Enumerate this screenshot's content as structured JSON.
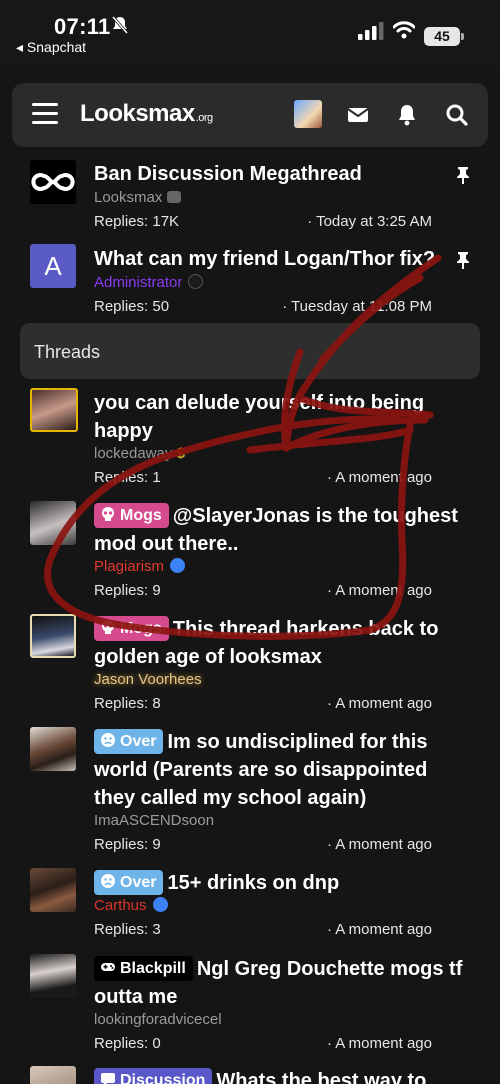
{
  "status": {
    "time": "07:11",
    "back_app": "◂ Snapchat",
    "battery": "45"
  },
  "header": {
    "logo_main": "Looksmax",
    "logo_suffix": ".org"
  },
  "pinned": [
    {
      "title": "Ban Discussion Megathread",
      "author": "Looksmax",
      "replies": "Replies: 17K",
      "time": "· Today at 3:25 AM"
    },
    {
      "title": "What can my friend Logan/Thor fix?",
      "author": "Administrator",
      "author_color": "#8b3cf0",
      "replies": "Replies: 50",
      "time": "· Tuesday at 11:08 PM",
      "avatar_letter": "A"
    }
  ],
  "section_label": "Threads",
  "threads": [
    {
      "prefix": "",
      "title": "you can delude yourself into being happy",
      "author": "lockedaway",
      "author_color": "#9b9b9b",
      "replies": "Replies: 1",
      "time": "· A moment ago"
    },
    {
      "prefix": "Mogs",
      "title": "@SlayerJonas is the toughest mod out there..",
      "author": "Plagiarism",
      "author_color": "#e33a2f",
      "replies": "Replies: 9",
      "time": "· A moment ago"
    },
    {
      "prefix": "Mogs",
      "title": "This thread harkens back to golden age of looksmax",
      "author": "Jason Voorhees",
      "author_color": "#e0c48a",
      "replies": "Replies: 8",
      "time": "· A moment ago"
    },
    {
      "prefix": "Over",
      "title": "Im so undisciplined for this world (Parents are so disappointed they called my school again)",
      "author": "ImaASCENDsoon",
      "author_color": "#9b9b9b",
      "replies": "Replies: 9",
      "time": "· A moment ago"
    },
    {
      "prefix": "Over",
      "title": "15+ drinks on dnp",
      "author": "Carthus",
      "author_color": "#d9332b",
      "replies": "Replies: 3",
      "time": "· A moment ago"
    },
    {
      "prefix": "Blackpill",
      "title": "Ngl Greg Douchette mogs tf outta me",
      "author": "lookingforadvicecel",
      "author_color": "#9b9b9b",
      "replies": "Replies: 0",
      "time": "· A moment ago"
    },
    {
      "prefix": "Discussion",
      "title": "Whats the best way to",
      "author": "",
      "replies": "",
      "time": ""
    }
  ],
  "colors": {
    "accent": "#d64b8e",
    "over": "#6fb4e8",
    "discussion": "#5a58c8",
    "scribble": "#8b1410"
  }
}
